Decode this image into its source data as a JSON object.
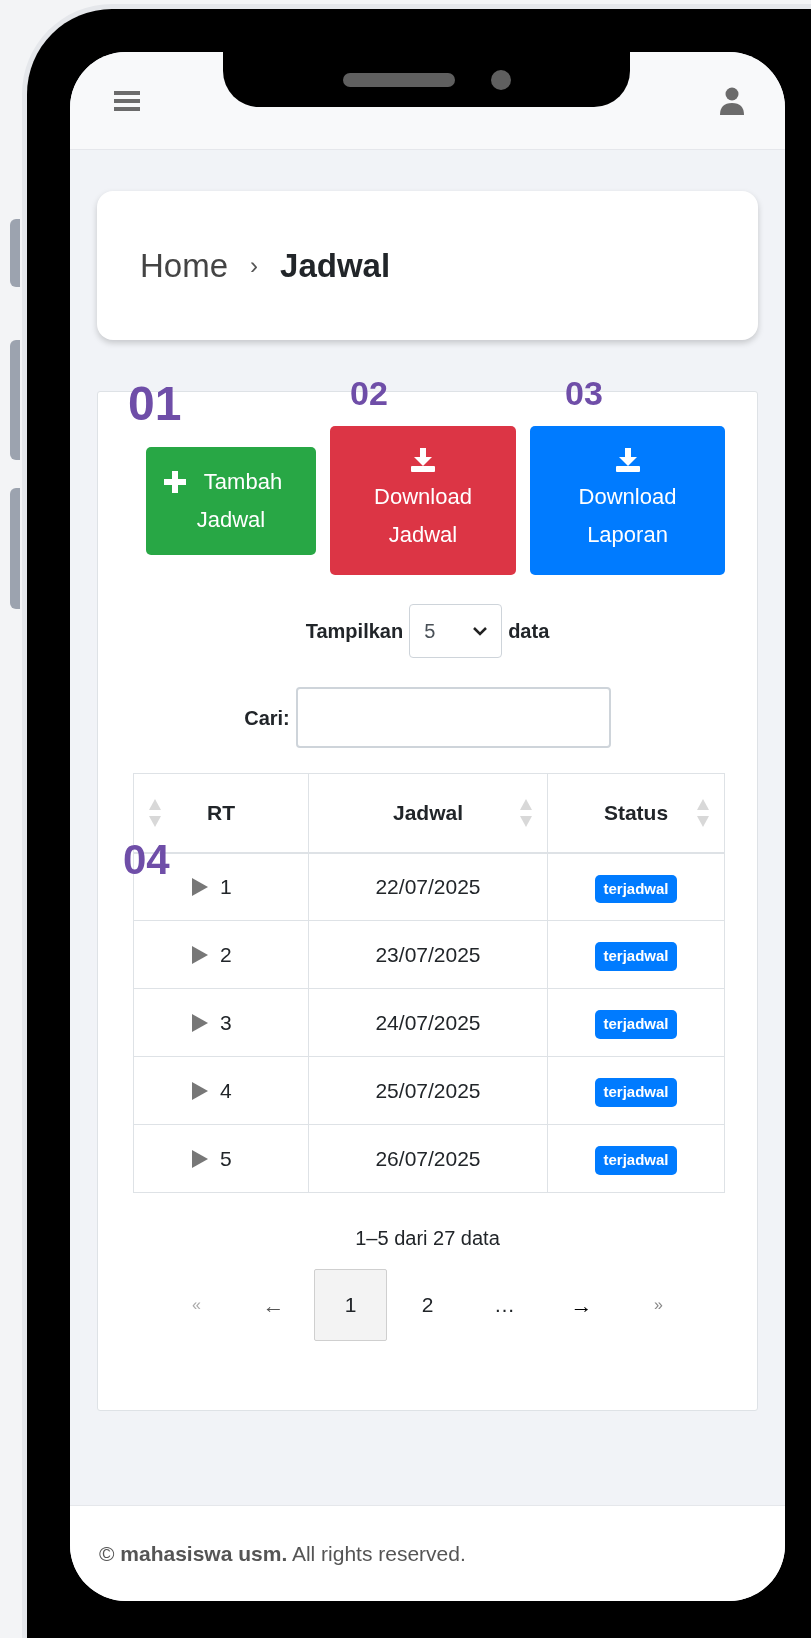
{
  "breadcrumb": {
    "items": [
      {
        "label": "Home",
        "current": false
      },
      {
        "label": "Jadwal",
        "current": true
      }
    ],
    "separator": "›"
  },
  "annotations": [
    {
      "label": "01",
      "kind": "large"
    },
    {
      "label": "02",
      "kind": "small"
    },
    {
      "label": "03",
      "kind": "small"
    },
    {
      "label": "04",
      "kind": "row"
    }
  ],
  "buttons": [
    {
      "label": "Tambah Jadwal",
      "kind": "add",
      "color": "#28a745"
    },
    {
      "label": "Download Jadwal",
      "kind": "download",
      "color": "#dc3545"
    },
    {
      "label": "Download Laporan",
      "kind": "download",
      "color": "#007bff"
    }
  ],
  "page_length": {
    "label": "Tampilkan",
    "value": "5",
    "suffix": "data"
  },
  "search": {
    "label": "Cari:"
  },
  "table": {
    "columns": [
      {
        "label": "RT"
      },
      {
        "label": "Jadwal"
      },
      {
        "label": "Status"
      }
    ],
    "rows": [
      {
        "rt": "1",
        "jadwal": "22/07/2025",
        "status": "terjadwal",
        "expanded": false
      },
      {
        "rt": "2",
        "jadwal": "23/07/2025",
        "status": "terjadwal",
        "expanded": false
      },
      {
        "rt": "3",
        "jadwal": "24/07/2025",
        "status": "terjadwal",
        "expanded": false
      },
      {
        "rt": "4",
        "jadwal": "25/07/2025",
        "status": "terjadwal",
        "expanded": false
      },
      {
        "rt": "5",
        "jadwal": "26/07/2025",
        "status": "terjadwal",
        "expanded": false
      }
    ]
  },
  "info": "1–5 dari 27 data",
  "pagination": [
    {
      "label": "«",
      "kind": "first",
      "selected": false
    },
    {
      "label": "←",
      "kind": "prev",
      "selected": false
    },
    {
      "label": "1",
      "kind": "page",
      "selected": true
    },
    {
      "label": "2",
      "kind": "page",
      "selected": false
    },
    {
      "label": "…",
      "kind": "ellipsis",
      "selected": false
    },
    {
      "label": "→",
      "kind": "next",
      "selected": false
    },
    {
      "label": "»",
      "kind": "last",
      "selected": false
    }
  ],
  "footer": "© **mahasiswa usm.** All rights reserved."
}
